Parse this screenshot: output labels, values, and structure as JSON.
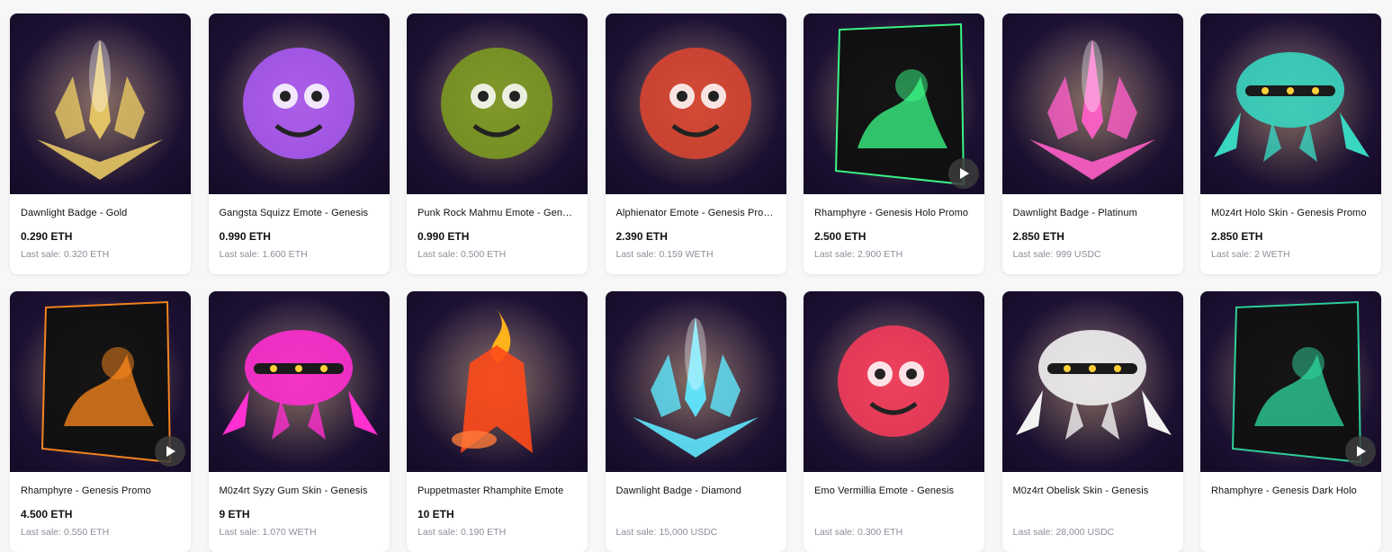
{
  "items": [
    {
      "title": "Dawnlight Badge - Gold",
      "price": "0.290 ETH",
      "last_label": "Last sale:",
      "last_value": "0.320 ETH",
      "video": false,
      "art": "gold-badge",
      "accent": "#e8c865"
    },
    {
      "title": "Gangsta Squizz Emote - Genesis",
      "price": "0.990 ETH",
      "last_label": "Last sale:",
      "last_value": "1.600 ETH",
      "video": false,
      "art": "emote",
      "accent": "#b15cff"
    },
    {
      "title": "Punk Rock Mahmu Emote - Genesis",
      "price": "0.990 ETH",
      "last_label": "Last sale:",
      "last_value": "0.500 ETH",
      "video": false,
      "art": "emote",
      "accent": "#7fa020"
    },
    {
      "title": "Alphienator Emote - Genesis Promo",
      "price": "2.390 ETH",
      "last_label": "Last sale:",
      "last_value": "0.159 WETH",
      "video": false,
      "art": "emote",
      "accent": "#e0452f"
    },
    {
      "title": "Rhamphyre - Genesis Holo Promo",
      "price": "2.500 ETH",
      "last_label": "Last sale:",
      "last_value": "2.900 ETH",
      "video": true,
      "art": "holo-card",
      "accent": "#3cff8a"
    },
    {
      "title": "Dawnlight Badge - Platinum",
      "price": "2.850 ETH",
      "last_label": "Last sale:",
      "last_value": "999 USDC",
      "video": false,
      "art": "platinum-badge",
      "accent": "#ff5fc8"
    },
    {
      "title": "M0z4rt Holo Skin - Genesis Promo",
      "price": "2.850 ETH",
      "last_label": "Last sale:",
      "last_value": "2 WETH",
      "video": false,
      "art": "robot",
      "accent": "#39d6c0"
    },
    {
      "title": "Rhamphyre - Genesis Promo",
      "price": "4.500 ETH",
      "last_label": "Last sale:",
      "last_value": "0.550 ETH",
      "video": true,
      "art": "holo-card",
      "accent": "#ff8a1e"
    },
    {
      "title": "M0z4rt Syzy Gum Skin - Genesis",
      "price": "9 ETH",
      "last_label": "Last sale:",
      "last_value": "1.070 WETH",
      "video": false,
      "art": "robot",
      "accent": "#ff2fd0"
    },
    {
      "title": "Puppetmaster Rhamphite Emote",
      "price": "10 ETH",
      "last_label": "Last sale:",
      "last_value": "0.190 ETH",
      "video": false,
      "art": "flame",
      "accent": "#ff4a1a"
    },
    {
      "title": "Dawnlight Badge - Diamond",
      "price": "",
      "last_label": "Last sale:",
      "last_value": "15,000 USDC",
      "video": false,
      "art": "diamond-badge",
      "accent": "#5fe8ff"
    },
    {
      "title": "Emo Vermillia Emote - Genesis",
      "price": "",
      "last_label": "Last sale:",
      "last_value": "0.300 ETH",
      "video": false,
      "art": "emote",
      "accent": "#ff3b5c"
    },
    {
      "title": "M0z4rt Obelisk Skin - Genesis",
      "price": "",
      "last_label": "Last sale:",
      "last_value": "28,000 USDC",
      "video": false,
      "art": "robot",
      "accent": "#f2f2f2"
    },
    {
      "title": "Rhamphyre - Genesis Dark Holo",
      "price": "",
      "last_label": "",
      "last_value": "",
      "video": true,
      "art": "holo-card",
      "accent": "#2fd8a0"
    }
  ]
}
